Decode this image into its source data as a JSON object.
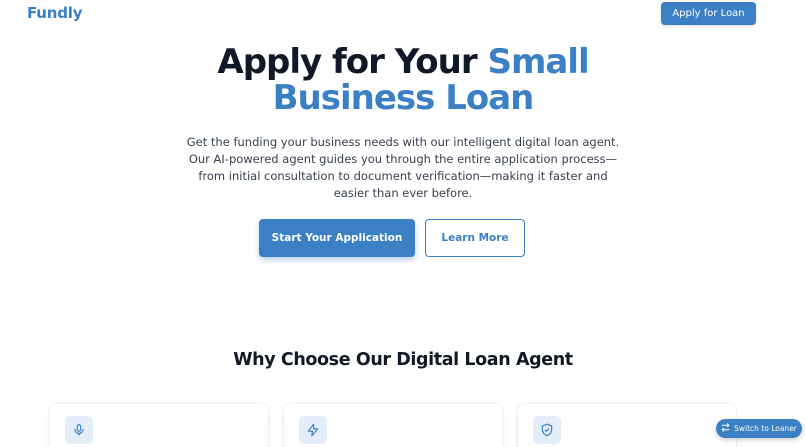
{
  "header": {
    "logo": "Fundly",
    "apply_label": "Apply for Loan"
  },
  "hero": {
    "title_part1": "Apply for Your ",
    "title_accent_1": "Small",
    "title_accent_2": "Business Loan",
    "description": "Get the funding your business needs with our intelligent digital loan agent. Our AI-powered agent guides you through the entire application process—from initial consultation to document verification—making it faster and easier than ever before.",
    "primary_cta": "Start Your Application",
    "secondary_cta": "Learn More"
  },
  "features": {
    "title": "Why Choose Our Digital Loan Agent",
    "cards": [
      {
        "icon": "microphone-icon"
      },
      {
        "icon": "lightning-icon"
      },
      {
        "icon": "shield-check-icon"
      }
    ]
  },
  "switch": {
    "label": "Switch to Loaner",
    "icon": "swap-icon"
  },
  "colors": {
    "accent": "#3b7fc4",
    "heading": "#111827",
    "icon_bg": "#e3eefa"
  }
}
